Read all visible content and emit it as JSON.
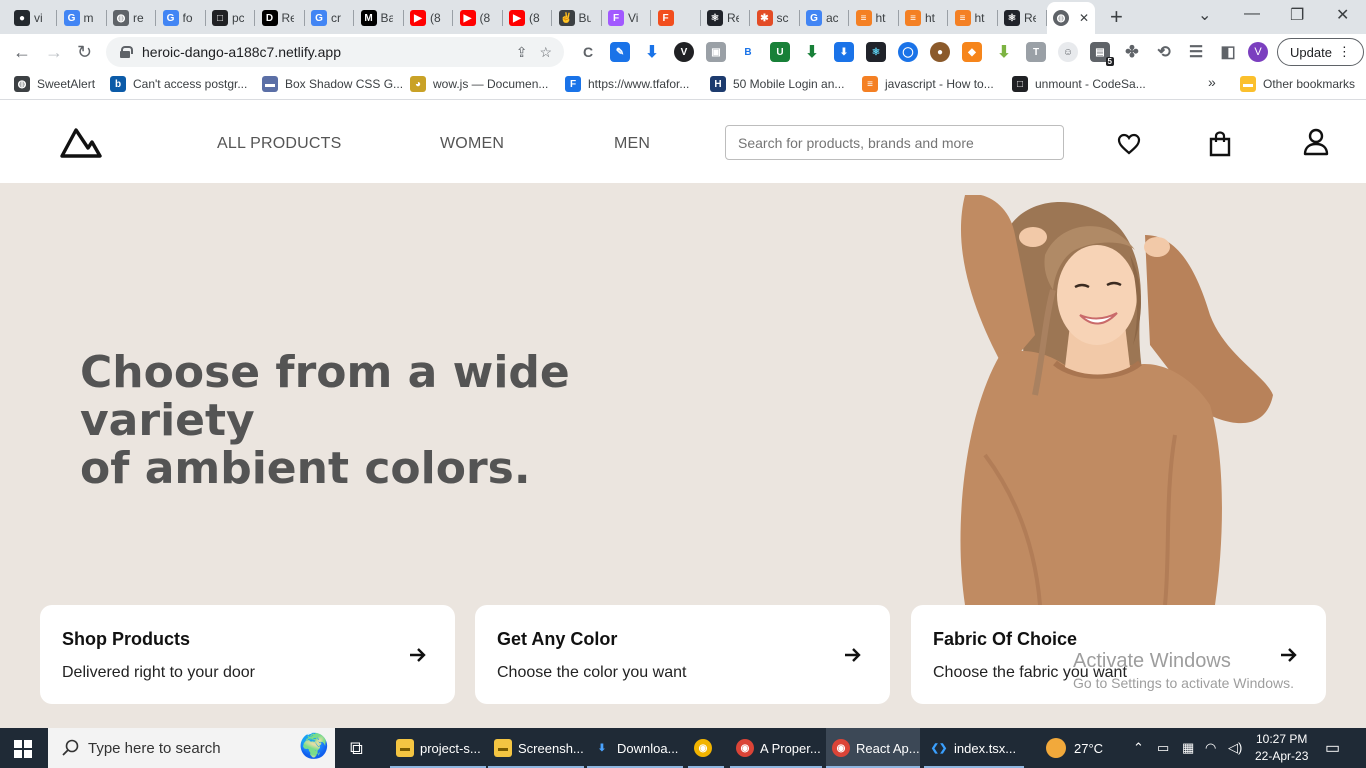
{
  "browser": {
    "tabs": [
      {
        "title": "vi",
        "icon": "github-icon",
        "color": "#24292e"
      },
      {
        "title": "m",
        "icon": "google-icon",
        "color": "#4285f4"
      },
      {
        "title": "re",
        "icon": "globe-icon",
        "color": "#5f6368"
      },
      {
        "title": "fo",
        "icon": "google-icon",
        "color": "#4285f4"
      },
      {
        "title": "pc",
        "icon": "square-icon",
        "color": "#202124"
      },
      {
        "title": "Re",
        "icon": "dev-icon",
        "color": "#000000"
      },
      {
        "title": "cr",
        "icon": "google-icon",
        "color": "#4285f4"
      },
      {
        "title": "Ba",
        "icon": "medium-icon",
        "color": "#000000"
      },
      {
        "title": "(8",
        "icon": "youtube-icon",
        "color": "#ff0000"
      },
      {
        "title": "(8",
        "icon": "youtube-icon",
        "color": "#ff0000"
      },
      {
        "title": "(8",
        "icon": "youtube-icon",
        "color": "#ff0000"
      },
      {
        "title": "Bu",
        "icon": "peace-icon",
        "color": "#3c4043"
      },
      {
        "title": "Vi",
        "icon": "figma-icon",
        "color": "#a259ff"
      },
      {
        "title": "",
        "icon": "figma-icon",
        "color": "#f24e1e"
      },
      {
        "title": "Re",
        "icon": "react-icon",
        "color": "#20232a"
      },
      {
        "title": "sc",
        "icon": "asterisk-icon",
        "color": "#e34c26"
      },
      {
        "title": "ac",
        "icon": "google-icon",
        "color": "#4285f4"
      },
      {
        "title": "ht",
        "icon": "stackoverflow-icon",
        "color": "#f48024"
      },
      {
        "title": "ht",
        "icon": "stackoverflow-icon",
        "color": "#f48024"
      },
      {
        "title": "ht",
        "icon": "stackoverflow-icon",
        "color": "#f48024"
      },
      {
        "title": "Re",
        "icon": "react-icon",
        "color": "#20232a"
      }
    ],
    "url": "heroic-dango-a188c7.netlify.app",
    "update_label": "Update",
    "profile_initial": "V",
    "extension_badge": "5",
    "bookmarks": [
      {
        "label": "SweetAlert",
        "icon": "globe-icon",
        "color": "#3c4043"
      },
      {
        "label": "Can't access postgr...",
        "icon": "bing-icon",
        "color": "#0c5ba8"
      },
      {
        "label": "Box Shadow CSS G...",
        "icon": "box-icon",
        "color": "#5b6fa6"
      },
      {
        "label": "wow.js — Documen...",
        "icon": "doge-icon",
        "color": "#c9a227"
      },
      {
        "label": "https://www.tfafor...",
        "icon": "f-icon",
        "color": "#1a73e8"
      },
      {
        "label": "50 Mobile Login an...",
        "icon": "h-icon",
        "color": "#1d3b6e"
      },
      {
        "label": "javascript - How to...",
        "icon": "stackoverflow-icon",
        "color": "#f48024"
      },
      {
        "label": "unmount - CodeSa...",
        "icon": "square-icon",
        "color": "#202124"
      }
    ],
    "other_bookmarks": "Other bookmarks",
    "more_chevron": "»"
  },
  "site": {
    "nav": {
      "links": [
        "ALL PRODUCTS",
        "WOMEN",
        "MEN"
      ],
      "search_placeholder": "Search for products, brands and more"
    },
    "hero": {
      "title_line1": "Choose from a wide variety",
      "title_line2": "of ambient colors."
    },
    "cards": [
      {
        "title": "Shop Products",
        "subtitle": "Delivered right to your door"
      },
      {
        "title": "Get Any Color",
        "subtitle": "Choose the color you want"
      },
      {
        "title": "Fabric Of Choice",
        "subtitle": "Choose the fabric you want"
      }
    ],
    "colors": {
      "hero_bg": "#ebe5df",
      "title": "#545454",
      "sweater": "#c08b62"
    }
  },
  "os": {
    "watermark_line1": "Activate Windows",
    "watermark_line2": "Go to Settings to activate Windows.",
    "search_placeholder": "Type here to search",
    "apps": [
      {
        "label": "project-s...",
        "icon": "folder-icon"
      },
      {
        "label": "Screensh...",
        "icon": "folder-icon"
      },
      {
        "label": "Downloa...",
        "icon": "download-icon"
      },
      {
        "label": "",
        "icon": "chrome-canary-icon"
      },
      {
        "label": "A Proper...",
        "icon": "chrome-icon"
      },
      {
        "label": "React Ap...",
        "icon": "chrome-icon"
      },
      {
        "label": "index.tsx...",
        "icon": "vscode-icon"
      }
    ],
    "weather": "27°C",
    "time": "10:27 PM",
    "date": "22-Apr-23"
  }
}
